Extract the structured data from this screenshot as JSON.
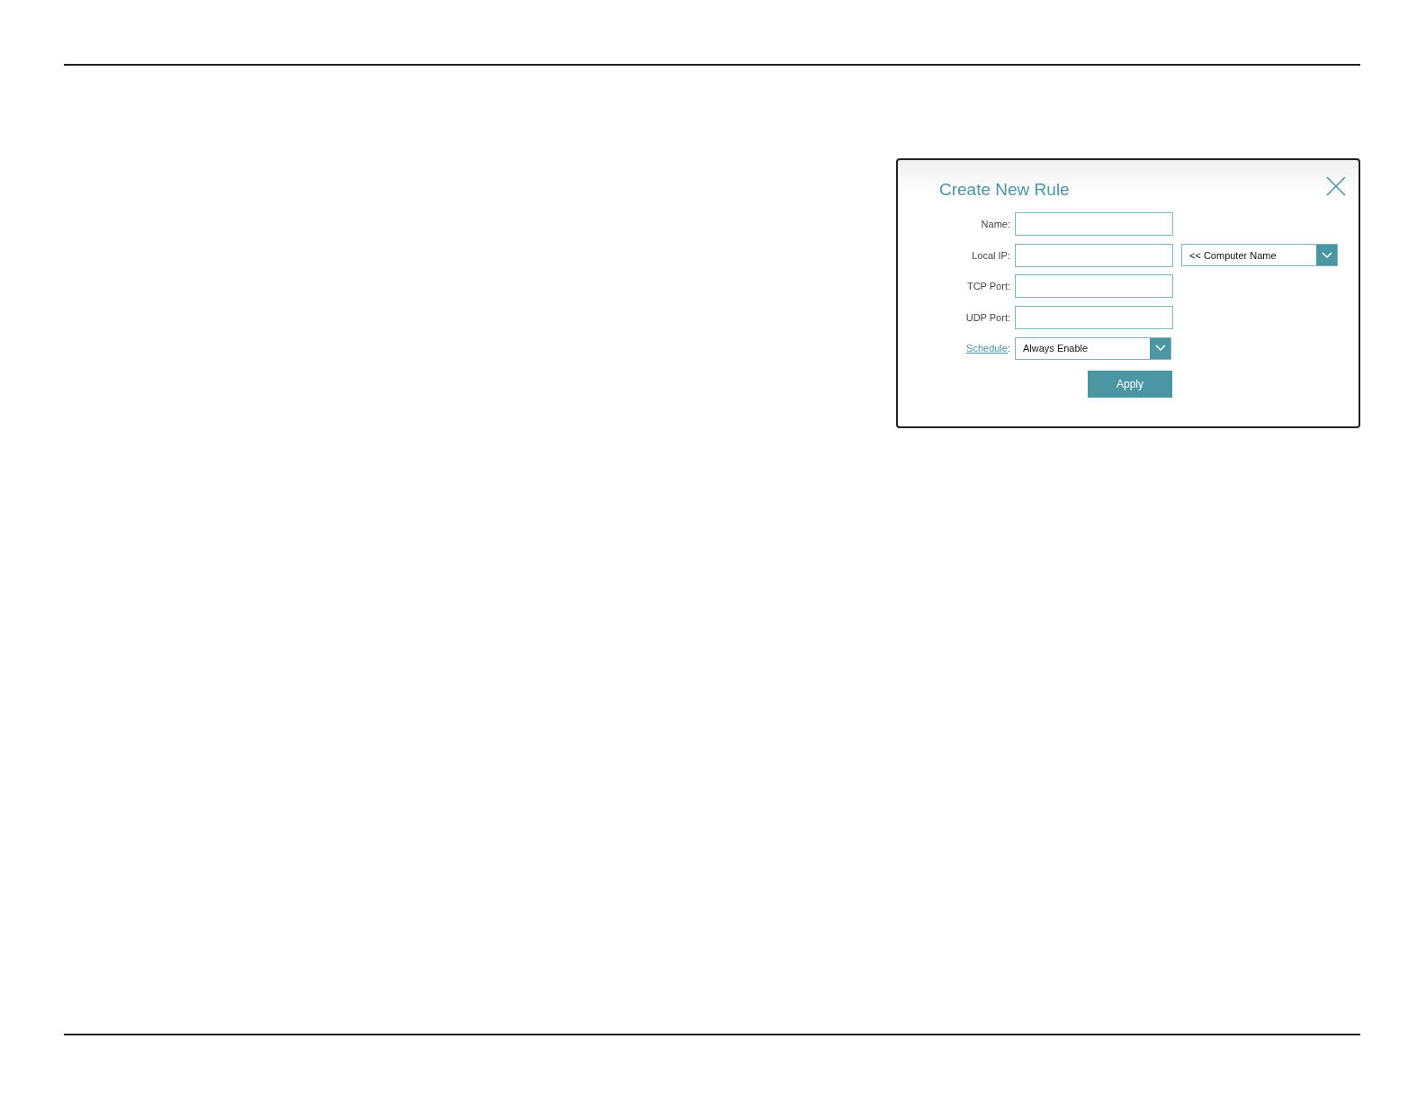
{
  "dialog": {
    "title": "Create New Rule",
    "fields": [
      {
        "kind": "text",
        "label": "Name:"
      },
      {
        "kind": "text",
        "label": "Local IP:",
        "picker": "<< Computer Name"
      },
      {
        "kind": "text",
        "label": "TCP Port:"
      },
      {
        "kind": "text",
        "label": "UDP Port:"
      },
      {
        "kind": "select",
        "label_link": "Schedule",
        "label_suffix": ":",
        "value": "Always Enable"
      }
    ],
    "button": "Apply"
  }
}
